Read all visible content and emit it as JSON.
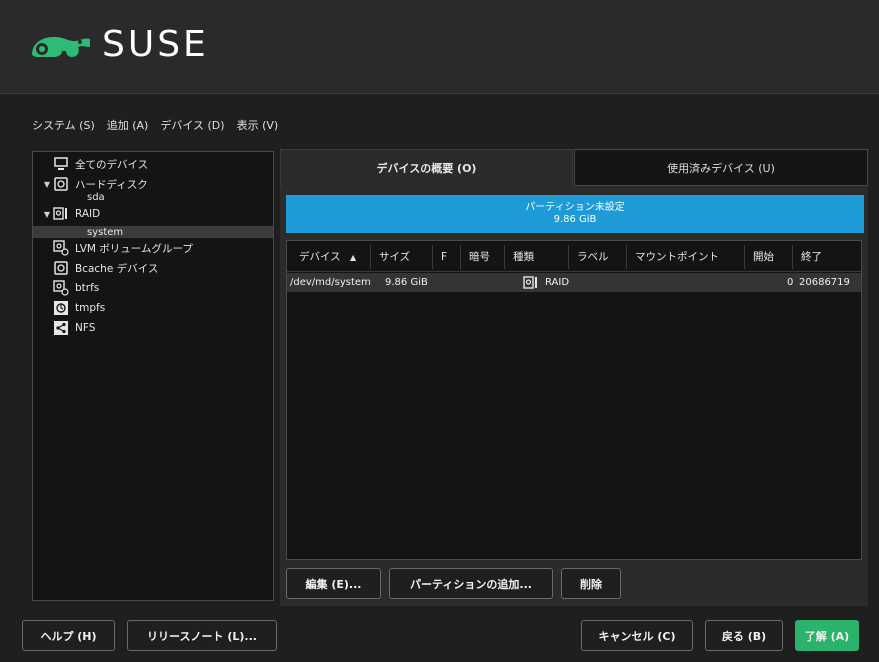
{
  "brand": {
    "name": "SUSE",
    "accent": "#30ba78"
  },
  "menubar": [
    {
      "label": "システム (S)"
    },
    {
      "label": "追加 (A)"
    },
    {
      "label": "デバイス (D)"
    },
    {
      "label": "表示 (V)"
    }
  ],
  "tree": {
    "items": [
      {
        "label": "全てのデバイス",
        "icon": "monitor-icon"
      },
      {
        "label": "ハードディスク",
        "icon": "harddisk-icon",
        "expanded": true
      },
      {
        "label": "sda"
      },
      {
        "label": "RAID",
        "icon": "raid-icon",
        "expanded": true
      },
      {
        "label": "system",
        "selected": true
      },
      {
        "label": "LVM ボリュームグループ",
        "icon": "lvm-icon"
      },
      {
        "label": "Bcache デバイス",
        "icon": "bcache-icon"
      },
      {
        "label": "btrfs",
        "icon": "btrfs-icon"
      },
      {
        "label": "tmpfs",
        "icon": "tmpfs-icon"
      },
      {
        "label": "NFS",
        "icon": "nfs-share-icon"
      }
    ]
  },
  "tabs": [
    {
      "label": "デバイスの概要 (O)",
      "active": true
    },
    {
      "label": "使用済みデバイス (U)",
      "active": false
    }
  ],
  "partition_bar": {
    "line1": "パーティション未設定",
    "line2": "9.86 GiB",
    "color": "#1e9bd7"
  },
  "table": {
    "columns": [
      "デバイス",
      "サイズ",
      "F",
      "暗号",
      "種類",
      "ラベル",
      "マウントポイント",
      "開始",
      "終了"
    ],
    "sort_indicator": "▲",
    "rows": [
      {
        "device": "/dev/md/system",
        "size": "9.86 GiB",
        "f": "",
        "enc": "",
        "type": "RAID",
        "type_icon": "raid-icon",
        "label": "",
        "mount": "",
        "start": "0",
        "end": "20686719"
      }
    ]
  },
  "actions": {
    "edit": "編集 (E)...",
    "add_partition": "パーティションの追加...",
    "delete": "削除"
  },
  "footer": {
    "help": "ヘルプ (H)",
    "release_notes": "リリースノート (L)...",
    "cancel": "キャンセル (C)",
    "back": "戻る (B)",
    "ok": "了解 (A)"
  }
}
